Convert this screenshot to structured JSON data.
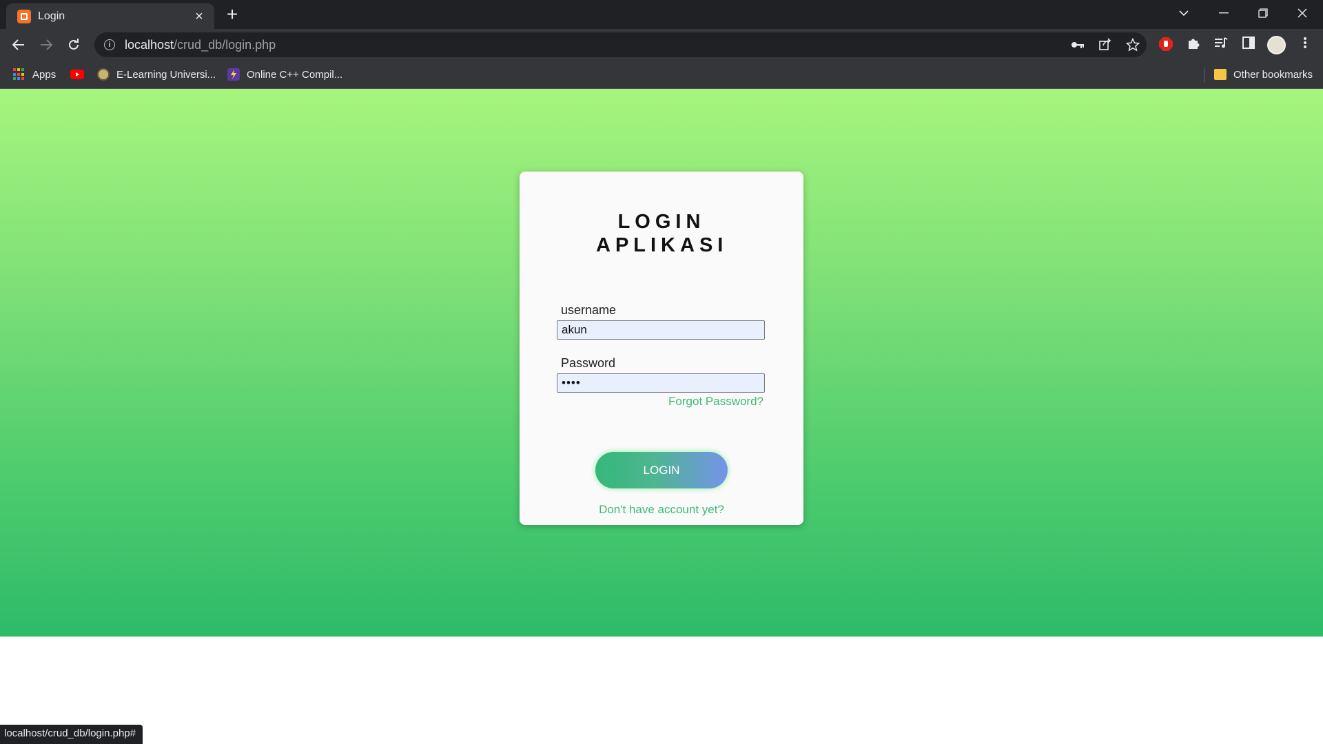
{
  "browser": {
    "tab": {
      "title": "Login",
      "close_glyph": "×"
    },
    "new_tab_glyph": "+",
    "url_host": "localhost",
    "url_path": "/crud_db/login.php",
    "bookmarks": [
      {
        "label": "Apps",
        "icon": "apps-grid-icon"
      },
      {
        "label": "",
        "icon": "youtube-icon"
      },
      {
        "label": "E-Learning Universi...",
        "icon": "university-icon"
      },
      {
        "label": "Online C++ Compil...",
        "icon": "bolt-icon"
      }
    ],
    "other_bookmarks": "Other bookmarks",
    "status_url": "localhost/crud_db/login.php#",
    "colors": {
      "tabbar": "#202124",
      "toolbar": "#35363a"
    }
  },
  "login": {
    "title": "LOGIN APLIKASI",
    "username_label": "username",
    "username_value": "akun",
    "password_label": "Password",
    "password_value": "••••",
    "forgot_link": "Forgot Password?",
    "login_button": "LOGIN",
    "signup_link": "Don't have account yet?",
    "colors": {
      "accent": "#3dbb6e",
      "button_start": "#34b87a",
      "button_end": "#7593ea"
    }
  }
}
